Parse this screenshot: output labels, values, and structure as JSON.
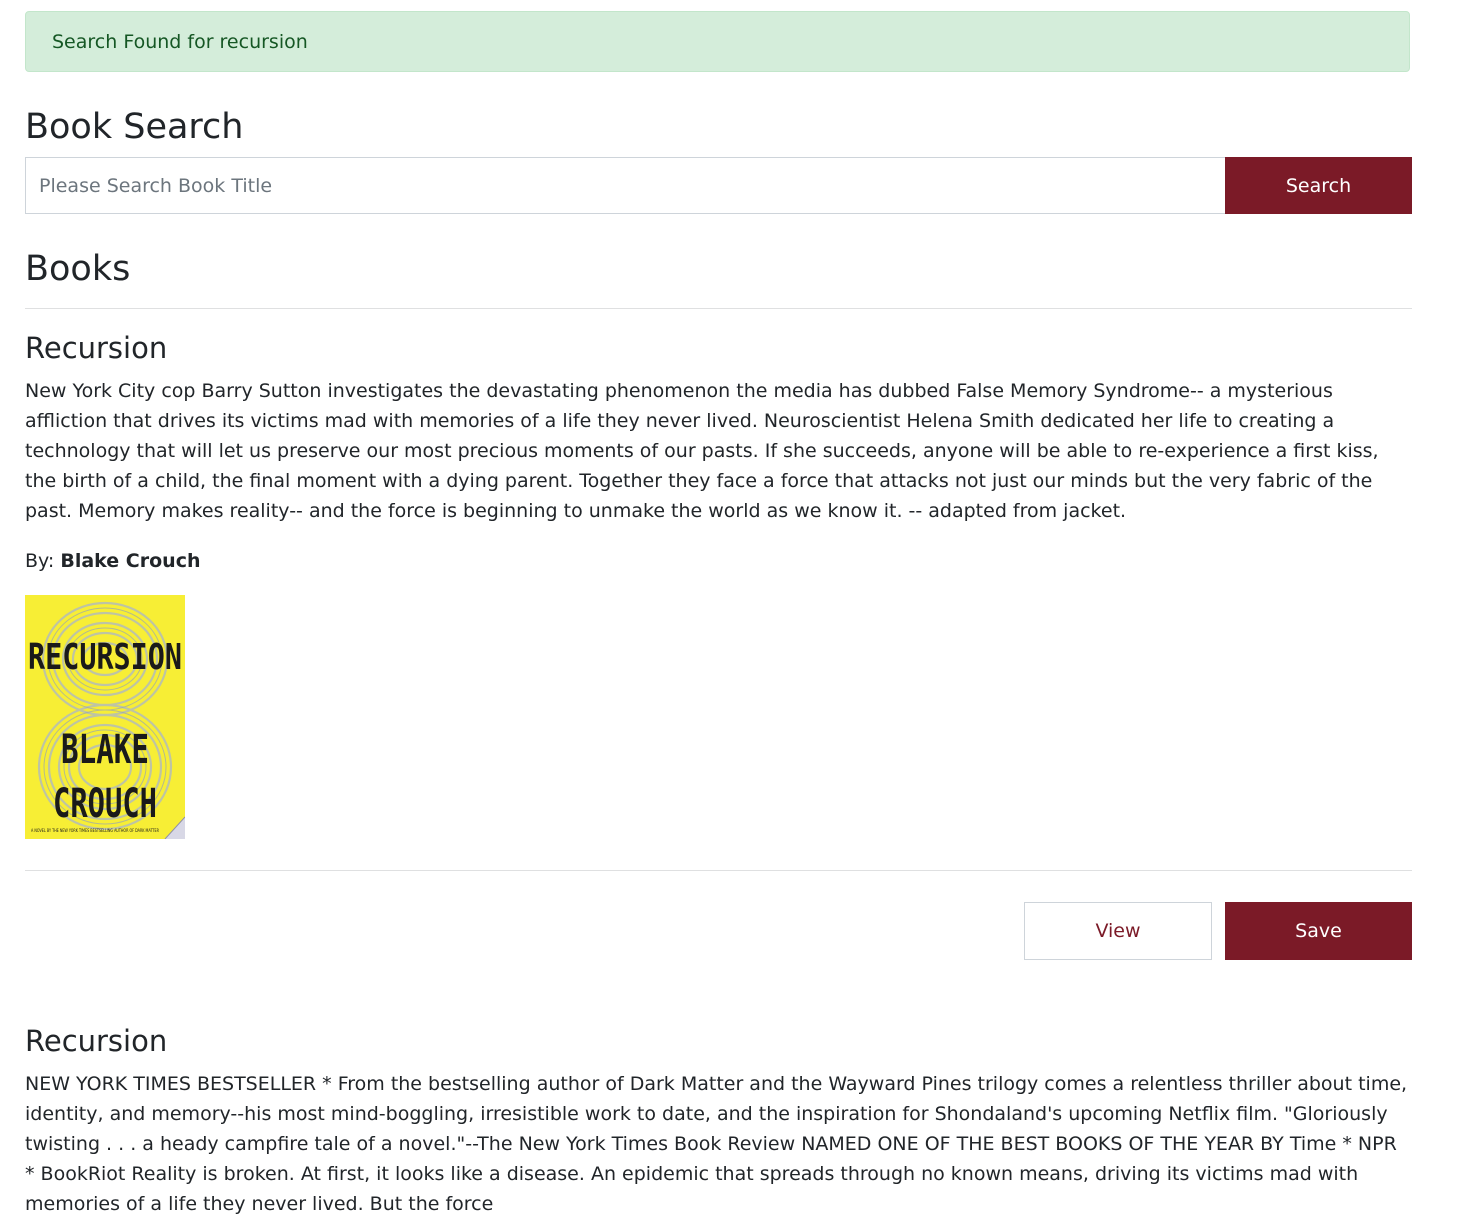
{
  "alert": {
    "text": "Search Found for recursion"
  },
  "search": {
    "heading": "Book Search",
    "placeholder": "Please Search Book Title",
    "button_label": "Search"
  },
  "books": {
    "heading": "Books",
    "items": [
      {
        "title": "Recursion",
        "description": "New York City cop Barry Sutton investigates the devastating phenomenon the media has dubbed False Memory Syndrome-- a mysterious affliction that drives its victims mad with memories of a life they never lived. Neuroscientist Helena Smith dedicated her life to creating a technology that will let us preserve our most precious moments of our pasts. If she succeeds, anyone will be able to re-experience a first kiss, the birth of a child, the final moment with a dying parent. Together they face a force that attacks not just our minds but the very fabric of the past. Memory makes reality-- and the force is beginning to unmake the world as we know it. -- adapted from jacket.",
        "by_label": "By:",
        "author": "Blake Crouch",
        "cover": {
          "title_text": "RECURSION",
          "author_line1": "BLAKE",
          "author_line2": "CROUCH",
          "tagline": "A NOVEL BY THE NEW YORK TIMES BESTSELLING AUTHOR OF DARK MATTER",
          "background_color": "#f7ee35"
        },
        "view_label": "View",
        "save_label": "Save"
      },
      {
        "title": "Recursion",
        "description": "NEW YORK TIMES BESTSELLER * From the bestselling author of Dark Matter and the Wayward Pines trilogy comes a relentless thriller about time, identity, and memory--his most mind-boggling, irresistible work to date, and the inspiration for Shondaland's upcoming Netflix film. \"Gloriously twisting . . . a heady campfire tale of a novel.\"--The New York Times Book Review NAMED ONE OF THE BEST BOOKS OF THE YEAR BY Time * NPR * BookRiot Reality is broken. At first, it looks like a disease. An epidemic that spreads through no known means, driving its victims mad with memories of a life they never lived. But the force"
      }
    ]
  },
  "colors": {
    "accent": "#7b1a27",
    "alert_background": "#d4edda",
    "alert_text": "#155724"
  }
}
